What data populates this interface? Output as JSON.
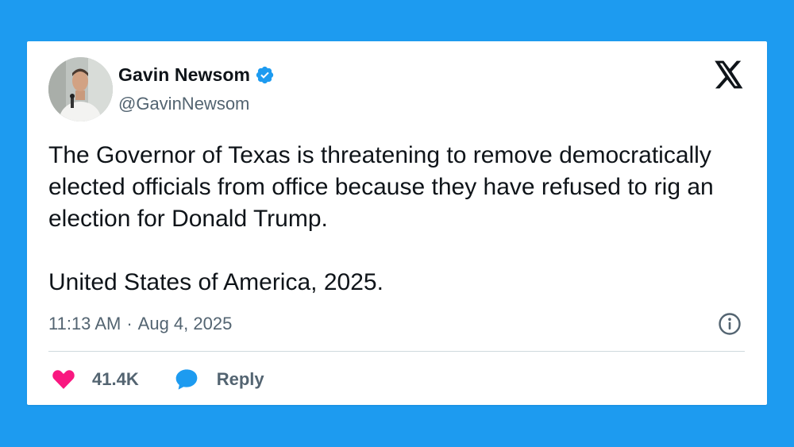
{
  "tweet": {
    "author": {
      "display_name": "Gavin Newsom",
      "handle": "@GavinNewsom",
      "verified": true,
      "verified_icon": "verified-badge-icon",
      "avatar": "profile-photo"
    },
    "platform_logo": "x-logo-icon",
    "text": {
      "paragraph_1": "The Governor of Texas is threatening to remove democratically elected officials from office because they have refused to rig an election for Donald Trump.",
      "paragraph_2": "United States of America, 2025."
    },
    "time": "11:13 AM",
    "separator": "·",
    "date": "Aug 4, 2025",
    "info_icon": "info-icon",
    "actions": {
      "like_count": "41.4K",
      "like_icon": "heart-icon",
      "reply_label": "Reply",
      "reply_icon": "speech-bubble-icon"
    }
  },
  "colors": {
    "background": "#1d9bf0",
    "card": "#ffffff",
    "text_primary": "#0f1419",
    "text_secondary": "#536471",
    "verified_blue": "#1d9bf0",
    "like_pink": "#f91880",
    "divider": "#cfd9de"
  }
}
